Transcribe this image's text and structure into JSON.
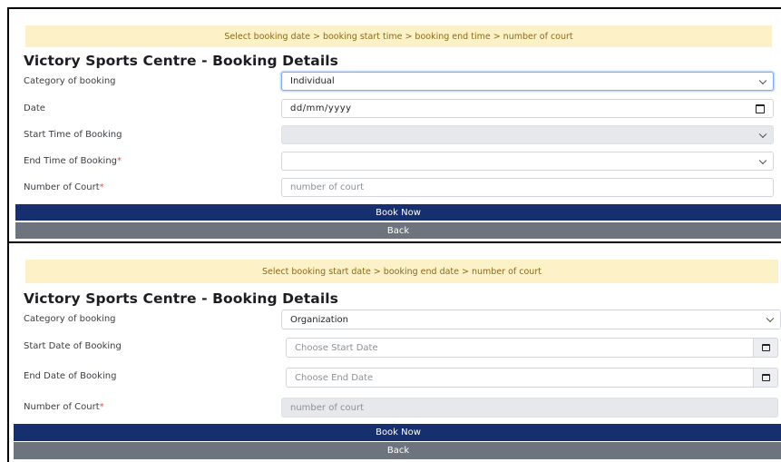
{
  "venue_title": "Victory Sports Centre - Booking Details",
  "individual_form": {
    "instruction": "Select booking date > booking start time > booking end time > number of court",
    "category_label": "Category of booking",
    "category_value": "Individual",
    "date_label": "Date",
    "date_value": "dd/mm/yyyy",
    "start_time_label": "Start Time of Booking",
    "start_time_value": "",
    "end_time_label": "End Time of Booking",
    "end_time_value": "",
    "courts_label": "Number of Court",
    "courts_placeholder": "number of court",
    "required_mark": "*",
    "book_now_label": "Book Now",
    "back_label": "Back"
  },
  "organization_form": {
    "instruction": "Select booking start date > booking end date > number of court",
    "category_label": "Category of booking",
    "category_value": "Organization",
    "start_date_label": "Start Date of Booking",
    "start_date_placeholder": "Choose Start Date",
    "end_date_label": "End Date of Booking",
    "end_date_placeholder": "Choose End Date",
    "courts_label": "Number of Court",
    "courts_placeholder": "number of court",
    "required_mark": "*",
    "book_now_label": "Book Now",
    "back_label": "Back"
  },
  "icons": {
    "select_arrow": "chevron-down-icon",
    "date_picker": "calendar-icon"
  },
  "colors": {
    "notice_bg": "#fdf1c7",
    "notice_text": "#8a6a1c",
    "primary_button": "#16306f",
    "secondary_button": "#6d747d",
    "required_mark": "#d9534f"
  }
}
